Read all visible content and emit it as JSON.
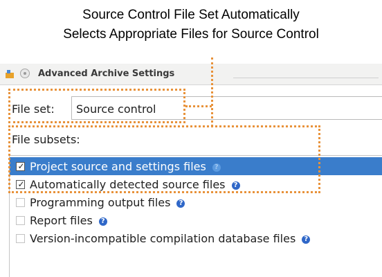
{
  "caption": {
    "line1": "Source Control File Set Automatically",
    "line2": "Selects Appropriate Files for  Source Control"
  },
  "window": {
    "title": "Advanced Archive Settings",
    "app_icon": "quartus-app-icon",
    "control_icon": "window-menu-icon"
  },
  "fileset": {
    "label": "File set:",
    "value": "Source control"
  },
  "subsets": {
    "label": "File subsets:",
    "items": [
      {
        "label": "Project source and settings files",
        "checked": true,
        "selected": true,
        "help_icon": "help-icon"
      },
      {
        "label": "Automatically detected source files",
        "checked": true,
        "selected": false,
        "help_icon": "help-icon"
      },
      {
        "label": "Programming output files",
        "checked": false,
        "selected": false,
        "help_icon": "help-icon"
      },
      {
        "label": "Report files",
        "checked": false,
        "selected": false,
        "help_icon": "help-icon"
      },
      {
        "label": "Version-incompatible compilation database files",
        "checked": false,
        "selected": false,
        "help_icon": "help-icon"
      }
    ]
  },
  "colors": {
    "selection": "#3a7dcb",
    "annotation": "#e8923a",
    "help_icon": "#2f67c8"
  }
}
